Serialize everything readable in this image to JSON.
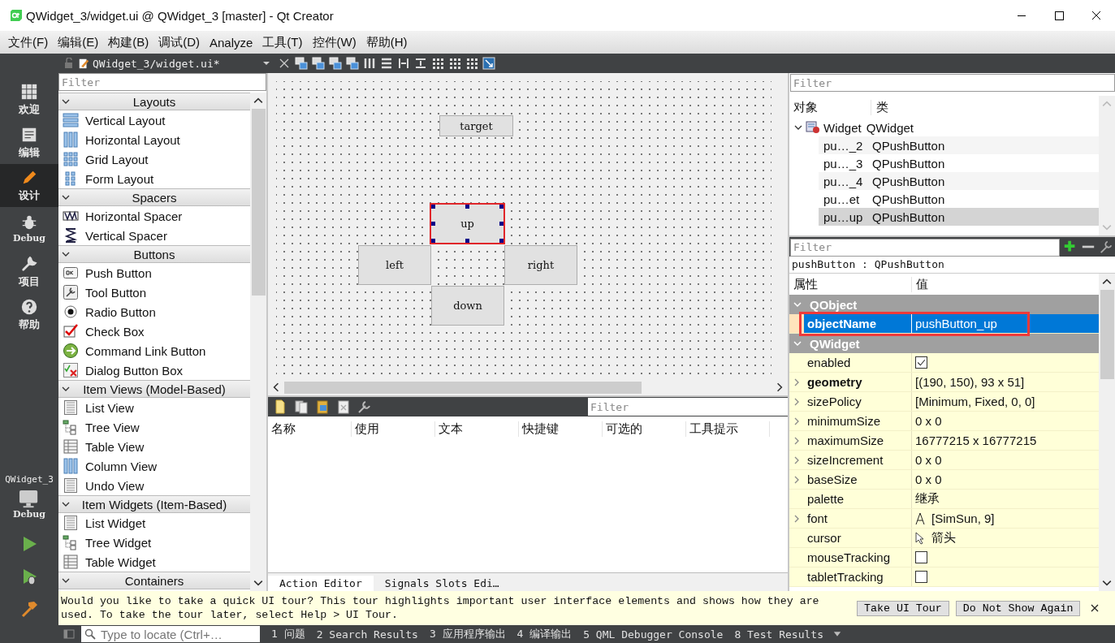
{
  "window": {
    "title": "QWidget_3/widget.ui @ QWidget_3 [master] - Qt Creator"
  },
  "menu": [
    "文件(F)",
    "编辑(E)",
    "构建(B)",
    "调试(D)",
    "Analyze",
    "工具(T)",
    "控件(W)",
    "帮助(H)"
  ],
  "mode_bar": {
    "items": [
      {
        "label": "欢迎",
        "selected": false
      },
      {
        "label": "编辑",
        "selected": false
      },
      {
        "label": "设计",
        "selected": true
      },
      {
        "label": "Debug",
        "selected": false
      },
      {
        "label": "项目",
        "selected": false
      },
      {
        "label": "帮助",
        "selected": false
      }
    ],
    "project": "QWidget_3",
    "build_config": "Debug"
  },
  "editor_tab": {
    "file": "QWidget_3/widget.ui*"
  },
  "widget_box": {
    "filter_placeholder": "Filter",
    "sections": [
      {
        "title": "Layouts",
        "expanded": true,
        "items": [
          "Vertical Layout",
          "Horizontal Layout",
          "Grid Layout",
          "Form Layout"
        ]
      },
      {
        "title": "Spacers",
        "expanded": true,
        "items": [
          "Horizontal Spacer",
          "Vertical Spacer"
        ]
      },
      {
        "title": "Buttons",
        "expanded": true,
        "items": [
          "Push Button",
          "Tool Button",
          "Radio Button",
          "Check Box",
          "Command Link Button",
          "Dialog Button Box"
        ]
      },
      {
        "title": "Item Views (Model-Based)",
        "expanded": true,
        "items": [
          "List View",
          "Tree View",
          "Table View",
          "Column View",
          "Undo View"
        ]
      },
      {
        "title": "Item Widgets (Item-Based)",
        "expanded": true,
        "items": [
          "List Widget",
          "Tree Widget",
          "Table Widget"
        ]
      },
      {
        "title": "Containers",
        "expanded": true
      }
    ]
  },
  "form": {
    "widgets": [
      {
        "text": "target",
        "selected": false
      },
      {
        "text": "up",
        "selected": true
      },
      {
        "text": "left",
        "selected": false
      },
      {
        "text": "right",
        "selected": false
      },
      {
        "text": "down",
        "selected": false
      }
    ]
  },
  "action_editor": {
    "filter_placeholder": "Filter",
    "columns": [
      "名称",
      "使用",
      "文本",
      "快捷键",
      "可选的",
      "工具提示"
    ],
    "tabs": [
      {
        "label": "Action Editor",
        "selected": true
      },
      {
        "label": "Signals  Slots Edi…",
        "selected": false
      }
    ]
  },
  "object_inspector": {
    "filter_placeholder": "Filter",
    "columns": [
      "对象",
      "类"
    ],
    "root": {
      "name": "Widget",
      "class": "QWidget",
      "expanded": true,
      "children": [
        {
          "name": "pu…_2",
          "class": "QPushButton",
          "selected": false
        },
        {
          "name": "pu…_3",
          "class": "QPushButton",
          "selected": false
        },
        {
          "name": "pu…_4",
          "class": "QPushButton",
          "selected": false
        },
        {
          "name": "pu…et",
          "class": "QPushButton",
          "selected": false
        },
        {
          "name": "pu…up",
          "class": "QPushButton",
          "selected": true
        }
      ]
    }
  },
  "property_editor": {
    "filter_placeholder": "Filter",
    "object_label": "pushButton : QPushButton",
    "columns": [
      "属性",
      "值"
    ],
    "rows": [
      {
        "kind": "group",
        "name": "QObject",
        "expanded": true
      },
      {
        "kind": "text",
        "name": "objectName",
        "value": "pushButton_up",
        "selected": true,
        "modified": true,
        "highlighted": true,
        "expandable": false
      },
      {
        "kind": "group",
        "name": "QWidget",
        "expanded": true
      },
      {
        "kind": "check",
        "name": "enabled",
        "checked": true,
        "selected": false,
        "modified": false,
        "expandable": false
      },
      {
        "kind": "text",
        "name": "geometry",
        "value": "[(190, 150), 93 x 51]",
        "selected": false,
        "modified": true,
        "expandable": true
      },
      {
        "kind": "text",
        "name": "sizePolicy",
        "value": "[Minimum, Fixed, 0, 0]",
        "selected": false,
        "modified": false,
        "expandable": true
      },
      {
        "kind": "text",
        "name": "minimumSize",
        "value": "0 x 0",
        "selected": false,
        "modified": false,
        "expandable": true
      },
      {
        "kind": "text",
        "name": "maximumSize",
        "value": "16777215 x 16777215",
        "selected": false,
        "modified": false,
        "expandable": true
      },
      {
        "kind": "text",
        "name": "sizeIncrement",
        "value": "0 x 0",
        "selected": false,
        "modified": false,
        "expandable": true
      },
      {
        "kind": "text",
        "name": "baseSize",
        "value": "0 x 0",
        "selected": false,
        "modified": false,
        "expandable": true
      },
      {
        "kind": "text",
        "name": "palette",
        "value": "继承",
        "selected": false,
        "modified": false,
        "expandable": false
      },
      {
        "kind": "font",
        "name": "font",
        "value": "[SimSun, 9]",
        "selected": false,
        "modified": false,
        "expandable": true
      },
      {
        "kind": "cursor",
        "name": "cursor",
        "value": "箭头",
        "selected": false,
        "modified": false,
        "expandable": false
      },
      {
        "kind": "check",
        "name": "mouseTracking",
        "checked": false,
        "selected": false,
        "modified": false,
        "expandable": false
      },
      {
        "kind": "check",
        "name": "tabletTracking",
        "checked": false,
        "selected": false,
        "modified": false,
        "expandable": false
      }
    ]
  },
  "tour": {
    "message": "Would you like to take a quick UI tour? This tour highlights important user interface elements and shows how they are used. To take the tour later, select Help > UI Tour.",
    "buttons": [
      "Take UI Tour",
      "Do Not Show Again"
    ]
  },
  "status_bar": {
    "locate_placeholder": "Type to locate (Ctrl+…",
    "panes": [
      "1 问题",
      "2 Search Results",
      "3 应用程序输出",
      "4 编译输出",
      "5 QML Debugger Console",
      "8 Test Results"
    ]
  }
}
